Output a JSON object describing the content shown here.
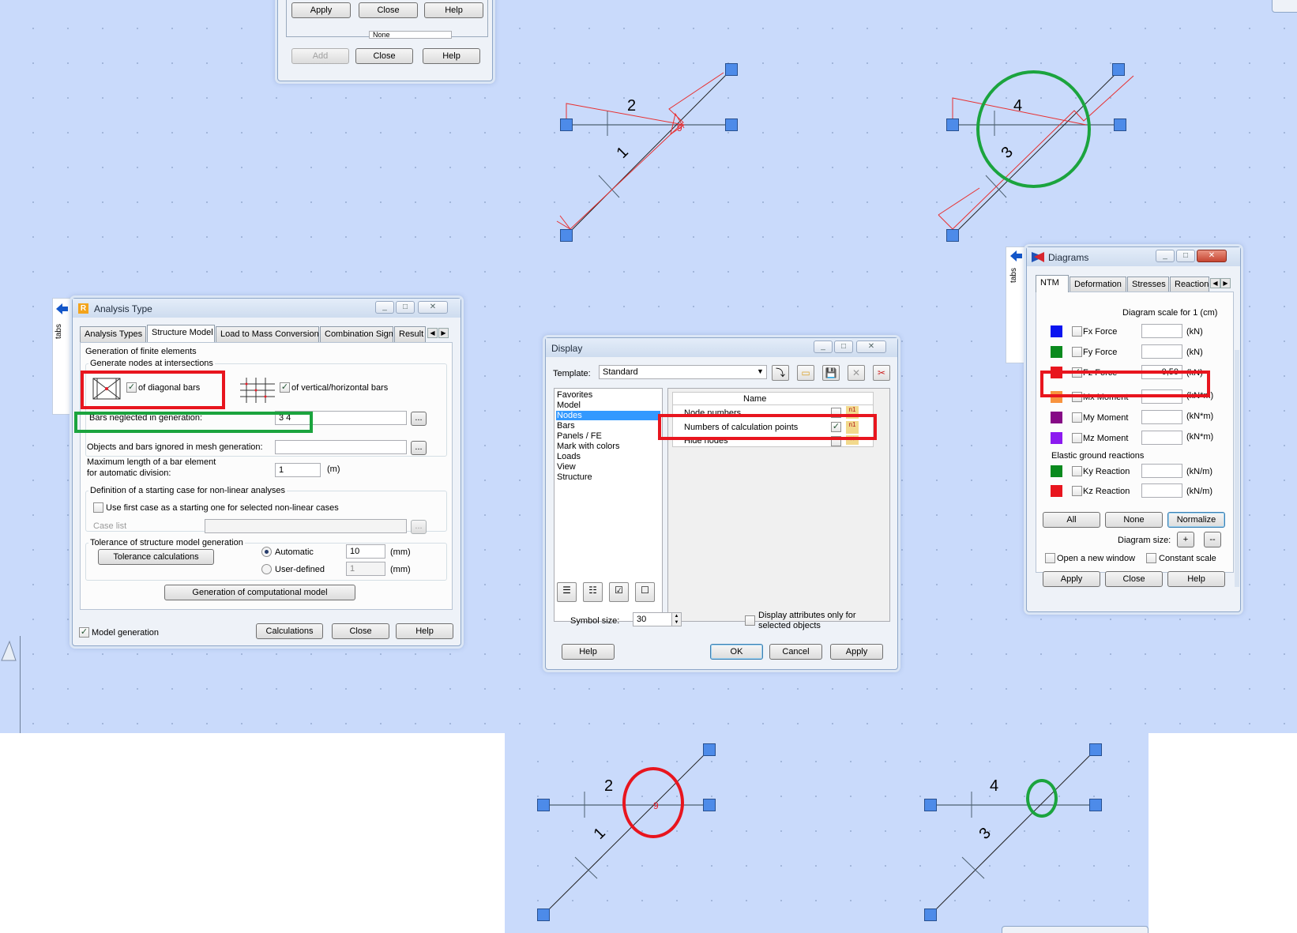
{
  "top_dialog": {
    "apply": "Apply",
    "close1": "Close",
    "help1": "Help",
    "selection_value": "None",
    "add": "Add",
    "close2": "Close",
    "help2": "Help"
  },
  "diagram_labels": {
    "bar2": "2",
    "bar1": "1",
    "point9": "9",
    "bar4": "4",
    "bar3": "3"
  },
  "side_tab": {
    "label": "tabs",
    "icon": "arrow-left-icon"
  },
  "analysis": {
    "title": "Analysis Type",
    "tabs": [
      "Analysis Types",
      "Structure Model",
      "Load to Mass Conversion",
      "Combination Sign",
      "Result I"
    ],
    "gen_fe": "Generation of finite elements",
    "gen_nodes": "Generate nodes at intersections",
    "diag_label": "of diagonal bars",
    "vh_label": "of vertical/horizontal bars",
    "neglect_label": "Bars neglected in generation:",
    "neglect_value": "3 4",
    "ignored_label": "Objects and bars ignored in mesh generation:",
    "maxlen_label1": "Maximum length of a bar element",
    "maxlen_label2": "for automatic division:",
    "maxlen_value": "1",
    "maxlen_unit": "(m)",
    "start_group": "Definition of a starting case for non-linear analyses",
    "use_first": "Use first case as a starting one for selected non-linear cases",
    "case_list": "Case list",
    "tol_group": "Tolerance of structure model generation",
    "tol_btn": "Tolerance calculations",
    "automatic": "Automatic",
    "auto_value": "10",
    "user_defined": "User-defined",
    "user_value": "1",
    "unit_mm": "(mm)",
    "gen_btn": "Generation of computational model",
    "model_gen": "Model generation",
    "calc": "Calculations",
    "close": "Close",
    "help": "Help",
    "ellipsis": "..."
  },
  "display": {
    "title": "Display",
    "template_label": "Template:",
    "template_value": "Standard",
    "categories": [
      "Favorites",
      "Model",
      "Nodes",
      "Bars",
      "Panels / FE",
      "Mark with colors",
      "Loads",
      "View",
      "Structure"
    ],
    "col_name": "Name",
    "rows": [
      {
        "name": "Node numbers",
        "checked": false
      },
      {
        "name": "Numbers of calculation points",
        "checked": true
      },
      {
        "name": "Hide nodes",
        "checked": false
      }
    ],
    "symbol_label": "Symbol size:",
    "symbol_value": "30",
    "attr_only1": "Display attributes only for",
    "attr_only2": "selected objects",
    "help": "Help",
    "ok": "OK",
    "cancel": "Cancel",
    "apply": "Apply"
  },
  "diagrams": {
    "title": "Diagrams",
    "tabs": [
      "NTM",
      "Deformation",
      "Stresses",
      "Reactions"
    ],
    "scale_label": "Diagram scale for 1  (cm)",
    "items": [
      {
        "label": "Fx Force",
        "color": "#0a14f0",
        "checked": false,
        "value": "",
        "unit": "(kN)"
      },
      {
        "label": "Fy Force",
        "color": "#0a8a1e",
        "checked": false,
        "value": "",
        "unit": "(kN)"
      },
      {
        "label": "Fz Force",
        "color": "#e8151e",
        "checked": true,
        "value": "0,50",
        "unit": "(kN)"
      },
      {
        "label": "Mx Moment",
        "color": "#f8933e",
        "checked": false,
        "value": "",
        "unit": "(kN*m)"
      },
      {
        "label": "My Moment",
        "color": "#860a86",
        "checked": false,
        "value": "",
        "unit": "(kN*m)"
      },
      {
        "label": "Mz Moment",
        "color": "#8c1af0",
        "checked": false,
        "value": "",
        "unit": "(kN*m)"
      }
    ],
    "elastic_label": "Elastic ground reactions",
    "reactions": [
      {
        "label": "Ky Reaction",
        "color": "#0a8a1e",
        "checked": false,
        "unit": "(kN/m)"
      },
      {
        "label": "Kz Reaction",
        "color": "#e8151e",
        "checked": false,
        "unit": "(kN/m)"
      }
    ],
    "all": "All",
    "none": "None",
    "normalize": "Normalize",
    "size_label": "Diagram size:",
    "plus": "+",
    "minus": "--",
    "new_window": "Open a new window",
    "constant": "Constant scale",
    "apply": "Apply",
    "close": "Close",
    "help": "Help"
  }
}
